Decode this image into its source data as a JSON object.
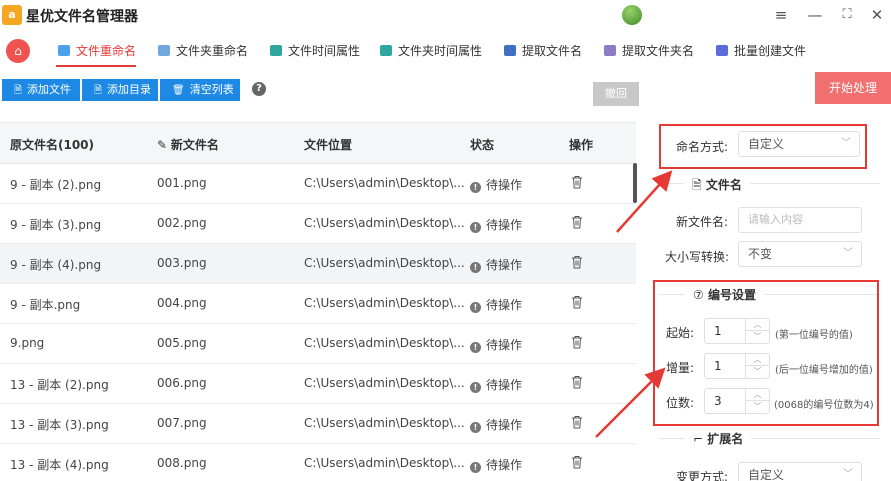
{
  "app": {
    "title": "星优文件名管理器",
    "logo_letter": "a"
  },
  "window": {
    "menu_icon": "≡",
    "minimize": "—",
    "maximize": "⛶",
    "close": "✕"
  },
  "tabs": [
    {
      "label": "文件重命名",
      "active": true
    },
    {
      "label": "文件夹重命名"
    },
    {
      "label": "文件时间属性"
    },
    {
      "label": "文件夹时间属性"
    },
    {
      "label": "提取文件名"
    },
    {
      "label": "提取文件夹名"
    },
    {
      "label": "批量创建文件"
    }
  ],
  "toolbar": {
    "add_file": "添加文件",
    "add_dir": "添加目录",
    "clear_list": "清空列表",
    "help": "?",
    "undo": "撤回",
    "start": "开始处理"
  },
  "table": {
    "headers": {
      "orig": "原文件名(100)",
      "new": "新文件名",
      "location": "文件位置",
      "status": "状态",
      "action": "操作"
    },
    "rows": [
      {
        "orig": "9 - 副本 (2).png",
        "new": "001.png",
        "loc": "C:\\Users\\admin\\Desktop\\...",
        "status": "待操作"
      },
      {
        "orig": "9 - 副本 (3).png",
        "new": "002.png",
        "loc": "C:\\Users\\admin\\Desktop\\...",
        "status": "待操作"
      },
      {
        "orig": "9 - 副本 (4).png",
        "new": "003.png",
        "loc": "C:\\Users\\admin\\Desktop\\...",
        "status": "待操作"
      },
      {
        "orig": "9 - 副本.png",
        "new": "004.png",
        "loc": "C:\\Users\\admin\\Desktop\\...",
        "status": "待操作"
      },
      {
        "orig": "9.png",
        "new": "005.png",
        "loc": "C:\\Users\\admin\\Desktop\\...",
        "status": "待操作"
      },
      {
        "orig": "13 - 副本 (2).png",
        "new": "006.png",
        "loc": "C:\\Users\\admin\\Desktop\\...",
        "status": "待操作"
      },
      {
        "orig": "13 - 副本 (3).png",
        "new": "007.png",
        "loc": "C:\\Users\\admin\\Desktop\\...",
        "status": "待操作"
      },
      {
        "orig": "13 - 副本 (4).png",
        "new": "008.png",
        "loc": "C:\\Users\\admin\\Desktop\\...",
        "status": "待操作"
      }
    ]
  },
  "panel": {
    "naming_mode_label": "命名方式:",
    "naming_mode_value": "自定义",
    "filename_section": "文件名",
    "new_filename_label": "新文件名:",
    "new_filename_placeholder": "请输入内容",
    "case_label": "大小写转换:",
    "case_value": "不变",
    "numbering_section": "编号设置",
    "start_label": "起始:",
    "start_value": "1",
    "start_hint": "(第一位编号的值)",
    "step_label": "增量:",
    "step_value": "1",
    "step_hint": "(后一位编号增加的值)",
    "digits_label": "位数:",
    "digits_value": "3",
    "digits_hint": "(0068的编号位数为4)",
    "ext_section": "扩展名",
    "ext_mode_label": "变更方式:",
    "ext_mode_value": "自定义"
  },
  "colors": {
    "accent": "#e53935",
    "primary": "#1e88e5",
    "start": "#f26f6f"
  }
}
